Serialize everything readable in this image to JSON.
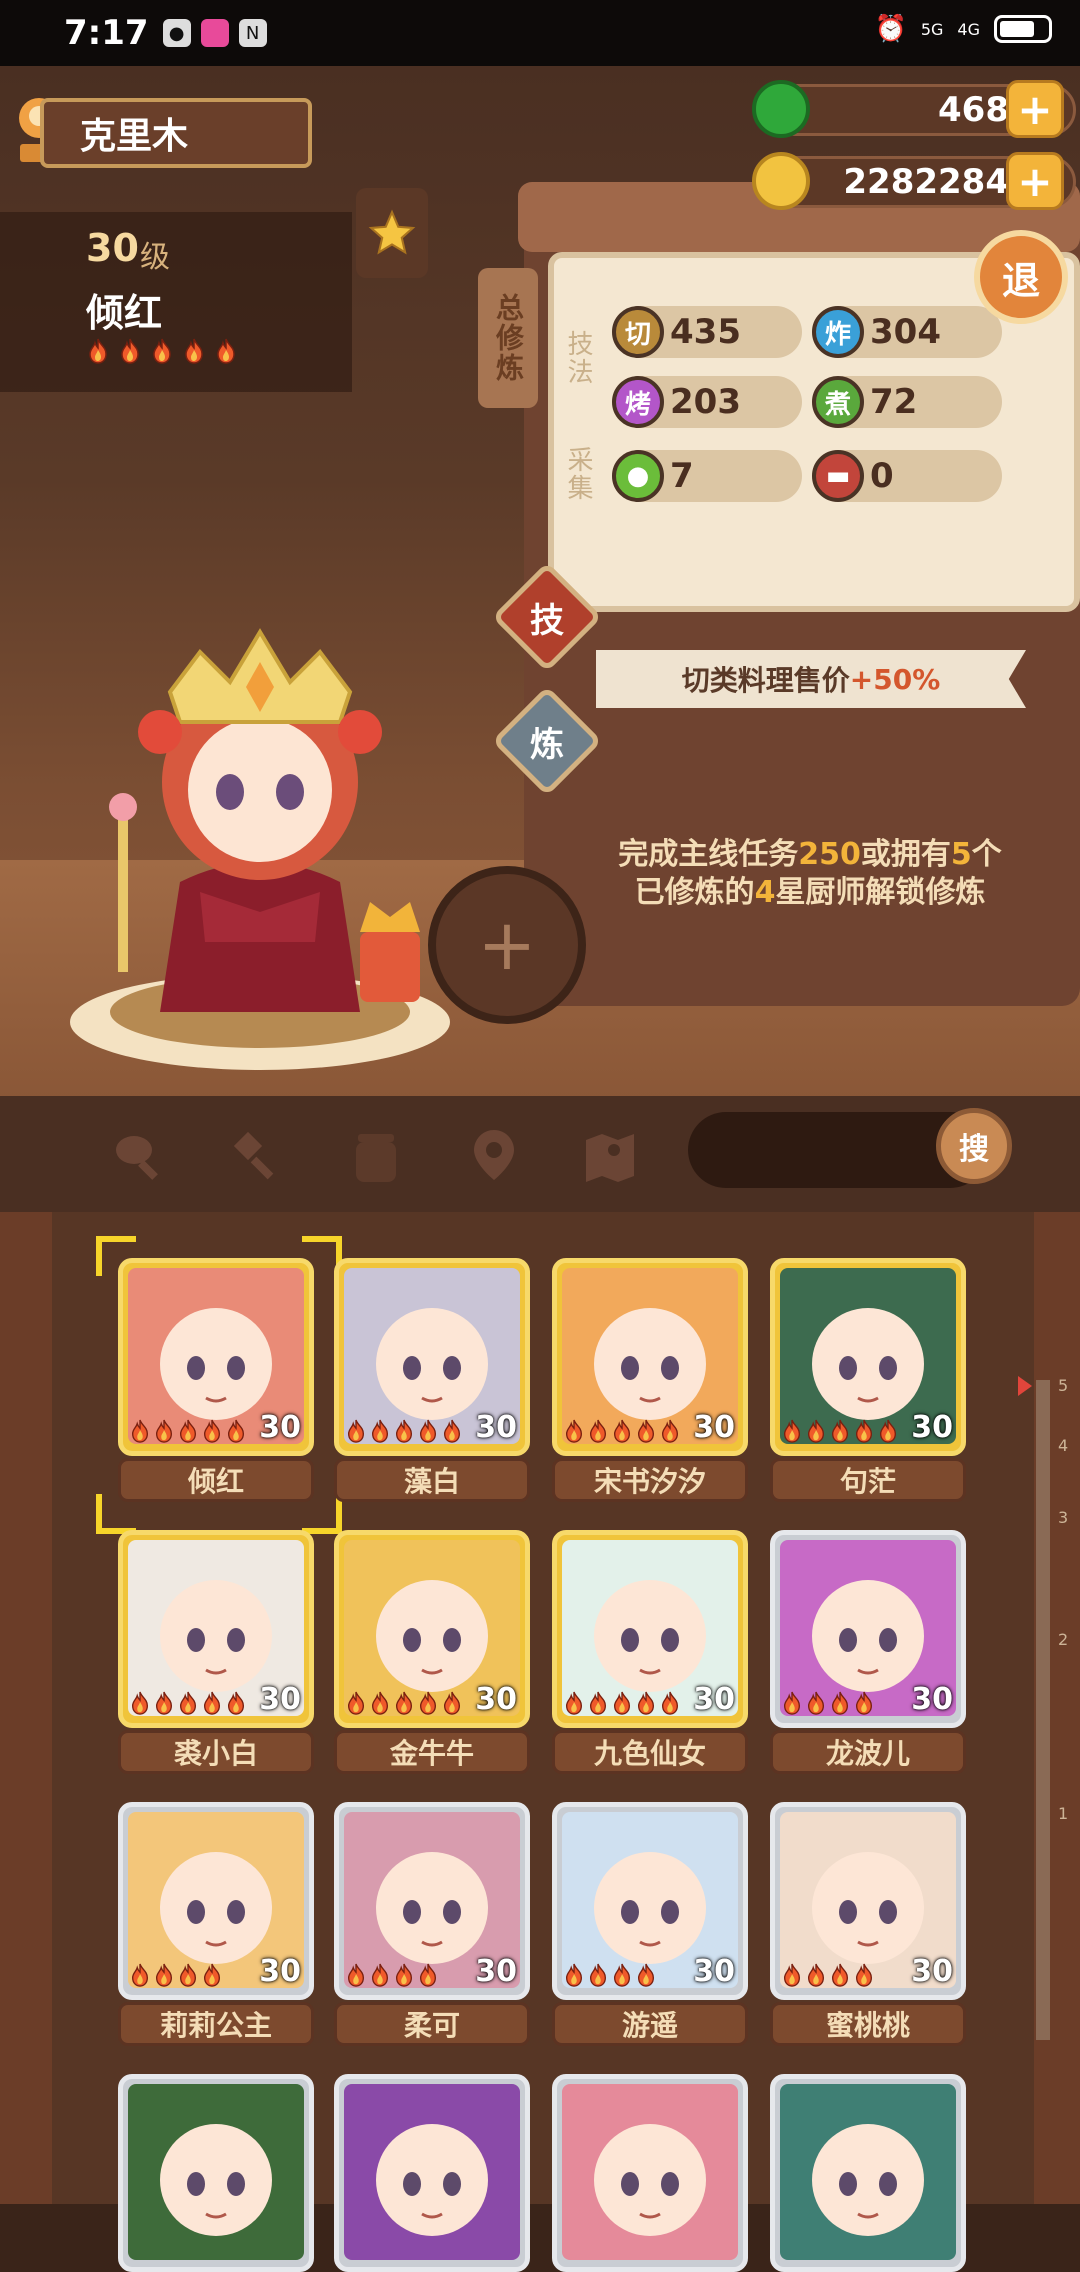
{
  "status_bar": {
    "time": "7:17",
    "signal1": "5G",
    "signal2": "4G"
  },
  "player": {
    "name": "克里木"
  },
  "currency": {
    "jade": "468",
    "coins": "2282284"
  },
  "exit_label": "退",
  "chef": {
    "level": "30",
    "level_unit": "级",
    "name": "倾红",
    "stars": 5
  },
  "panel": {
    "tab_label": "总修炼",
    "technique_label": "技法",
    "gather_label": "采集",
    "skills": [
      {
        "icon": "切",
        "value": "435",
        "color": "#b98a3a"
      },
      {
        "icon": "炸",
        "value": "304",
        "color": "#3aa0d8"
      },
      {
        "icon": "烤",
        "value": "203",
        "color": "#b356c9"
      },
      {
        "icon": "煮",
        "value": "72",
        "color": "#5aa83c"
      }
    ],
    "gather": [
      {
        "icon": "vegetable-icon",
        "value": "7",
        "color": "#6bbd3a"
      },
      {
        "icon": "meat-icon",
        "value": "0",
        "color": "#c2453b"
      }
    ]
  },
  "side_buttons": {
    "skill": "技",
    "refine": "炼"
  },
  "bonus": {
    "text": "切类料理售价",
    "value": "+50%"
  },
  "unlock": {
    "line1_a": "完成主线任务",
    "line1_b": "250",
    "line1_c": "或拥有",
    "line1_d": "5",
    "line1_e": "个",
    "line2_a": "已修炼的",
    "line2_b": "4",
    "line2_c": "星厨师解锁修炼"
  },
  "search_label": "搜",
  "filter_icons": [
    "meat-leg-icon",
    "shovel-icon",
    "jar-icon",
    "location-pin-icon",
    "map-icon"
  ],
  "ruler_marks": [
    "5",
    "4",
    "3",
    "2",
    "1"
  ],
  "chefs": [
    {
      "name": "倾红",
      "level": "30",
      "tier": "gold",
      "color": "#e98b77",
      "flames": 5,
      "selected": true
    },
    {
      "name": "藻白",
      "level": "30",
      "tier": "gold",
      "color": "#c9c4d6",
      "flames": 5
    },
    {
      "name": "宋书汐汐",
      "level": "30",
      "tier": "gold",
      "color": "#f2a95b",
      "flames": 5
    },
    {
      "name": "句茫",
      "level": "30",
      "tier": "gold",
      "color": "#3d6b4f",
      "flames": 5
    },
    {
      "name": "裘小白",
      "level": "30",
      "tier": "gold",
      "color": "#efe9e2",
      "flames": 5
    },
    {
      "name": "金牛牛",
      "level": "30",
      "tier": "gold",
      "color": "#f0c25a",
      "flames": 5
    },
    {
      "name": "九色仙女",
      "level": "30",
      "tier": "gold",
      "color": "#e3f1ea",
      "flames": 5
    },
    {
      "name": "龙波儿",
      "level": "30",
      "tier": "silver",
      "color": "#c76ac6",
      "flames": 4
    },
    {
      "name": "莉莉公主",
      "level": "30",
      "tier": "silver",
      "color": "#f3c67a",
      "flames": 4
    },
    {
      "name": "柔可",
      "level": "30",
      "tier": "silver",
      "color": "#d89cae",
      "flames": 4
    },
    {
      "name": "游遥",
      "level": "30",
      "tier": "silver",
      "color": "#cfe0f0",
      "flames": 4
    },
    {
      "name": "蜜桃桃",
      "level": "30",
      "tier": "silver",
      "color": "#f1dccb",
      "flames": 4
    },
    {
      "name": "",
      "level": "",
      "tier": "silver",
      "color": "#3e6b3a",
      "flames": 0
    },
    {
      "name": "",
      "level": "",
      "tier": "silver",
      "color": "#8a4aa8",
      "flames": 0
    },
    {
      "name": "",
      "level": "",
      "tier": "silver",
      "color": "#e58a9a",
      "flames": 0
    },
    {
      "name": "",
      "level": "",
      "tier": "silver",
      "color": "#3f7f74",
      "flames": 0
    }
  ]
}
